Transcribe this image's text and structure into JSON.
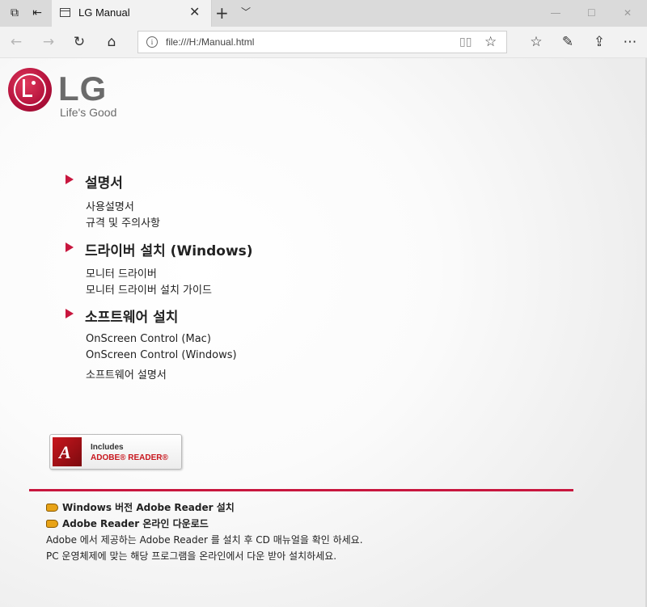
{
  "browser": {
    "tab_title": "LG Manual",
    "url": "file:///H:/Manual.html"
  },
  "logo": {
    "text": "LG",
    "slogan": "Life's Good"
  },
  "sections": [
    {
      "title": "설명서",
      "links": [
        "사용설명서",
        "규격 및 주의사항"
      ]
    },
    {
      "title": "드라이버 설치 (Windows)",
      "links": [
        "모니터 드라이버",
        "모니터 드라이버 설치 가이드"
      ]
    },
    {
      "title": "소프트웨어 설치",
      "links": [
        "OnScreen Control (Mac)",
        "OnScreen Control (Windows)",
        "소프트웨어 설명서"
      ]
    }
  ],
  "adobe_badge": {
    "line1": "Includes",
    "line2": "ADOBE® READER®"
  },
  "footer": {
    "link1": "Windows 버전 Adobe Reader 설치",
    "link2": "Adobe Reader 온라인 다운로드",
    "text1": "Adobe 에서 제공하는 Adobe Reader 를 설치 후 CD 매뉴얼을 확인 하세요.",
    "text2": "PC 운영체제에 맞는 해당 프로그램을 온라인에서 다운 받아 설치하세요."
  },
  "colors": {
    "accent": "#c8163e",
    "logo_gray": "#6b6b6b"
  }
}
